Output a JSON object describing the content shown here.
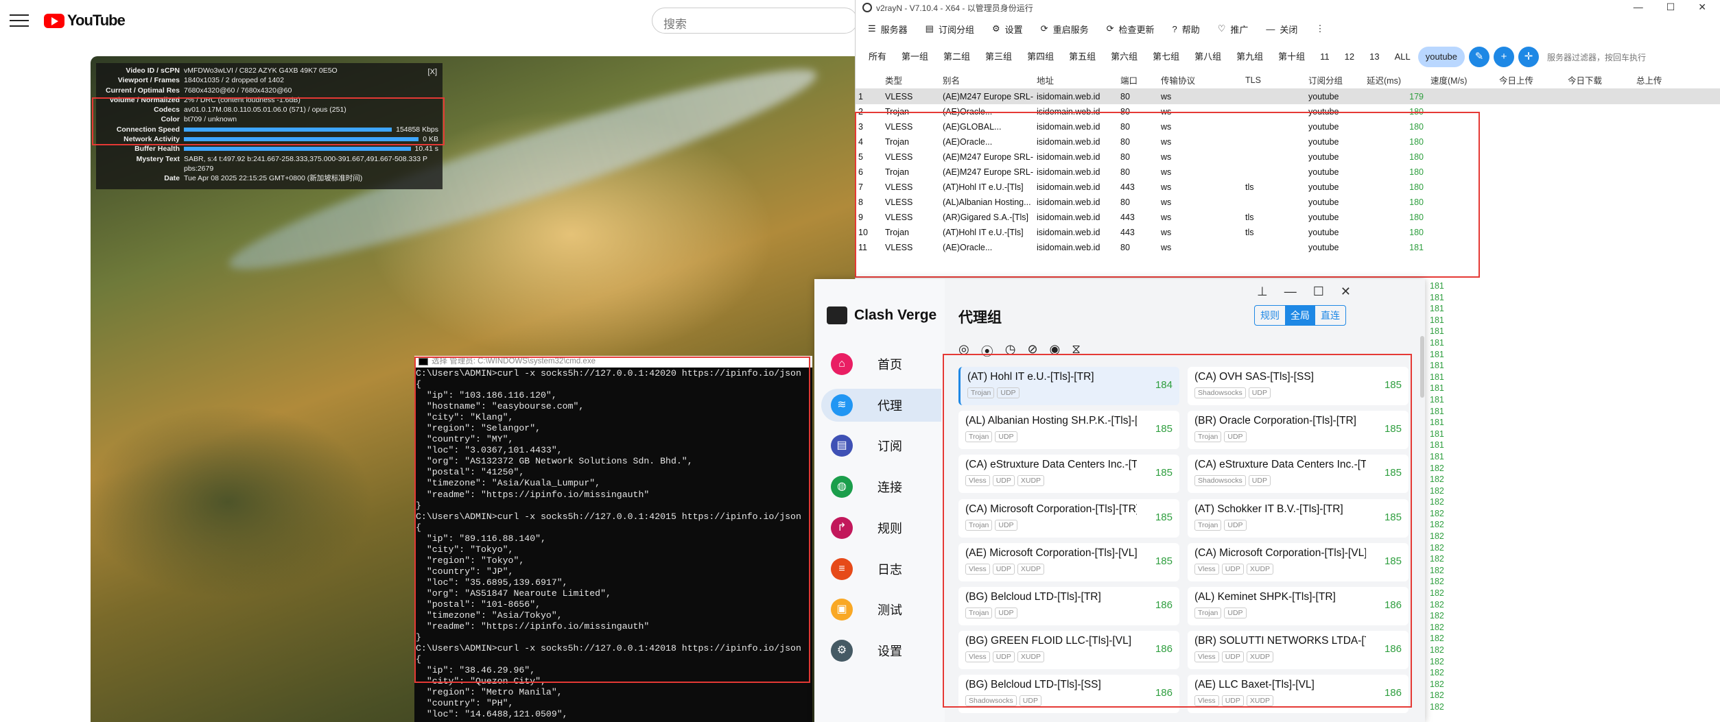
{
  "youtube": {
    "logo_text": "YouTube",
    "search_placeholder": "搜索"
  },
  "stats": {
    "rows": [
      {
        "k": "Video ID / sCPN",
        "v": "vMFDWo3wLVI / C822 AZYK G4XB 49K7 0E5O"
      },
      {
        "k": "Viewport / Frames",
        "v": "1840x1035 / 2 dropped of 1402"
      },
      {
        "k": "Current / Optimal Res",
        "v": "7680x4320@60 / 7680x4320@60"
      },
      {
        "k": "Volume / Normalized",
        "v": "2% / DRC (content loudness -1.6dB)"
      },
      {
        "k": "Codecs",
        "v": "av01.0.17M.08.0.110.05.01.06.0 (571) / opus (251)"
      },
      {
        "k": "Color",
        "v": "bt709 / unknown"
      },
      {
        "k": "Connection Speed",
        "v": "154858 Kbps",
        "bar": true
      },
      {
        "k": "Network Activity",
        "v": "0 KB",
        "bar": true
      },
      {
        "k": "Buffer Health",
        "v": "10.41 s",
        "bar": true
      },
      {
        "k": "Mystery Text",
        "v": "SABR, s:4 t:497.92 b:241.667-258.333,375.000-391.667,491.667-508.333 P"
      },
      {
        "k": "",
        "v": "pbs:2679"
      },
      {
        "k": "Date",
        "v": "Tue Apr 08 2025 22:15:25 GMT+0800 (新加坡标准时间)"
      }
    ],
    "close": "[X]"
  },
  "cmd": {
    "title": "选择 管理员: C:\\WINDOWS\\system32\\cmd.exe",
    "lines": [
      "C:\\Users\\ADMIN>curl -x socks5h://127.0.0.1:42020 https://ipinfo.io/json",
      "{",
      "  \"ip\": \"103.186.116.120\",",
      "  \"hostname\": \"easybourse.com\",",
      "  \"city\": \"Klang\",",
      "  \"region\": \"Selangor\",",
      "  \"country\": \"MY\",",
      "  \"loc\": \"3.0367,101.4433\",",
      "  \"org\": \"AS132372 GB Network Solutions Sdn. Bhd.\",",
      "  \"postal\": \"41250\",",
      "  \"timezone\": \"Asia/Kuala_Lumpur\",",
      "  \"readme\": \"https://ipinfo.io/missingauth\"",
      "}",
      "C:\\Users\\ADMIN>curl -x socks5h://127.0.0.1:42015 https://ipinfo.io/json",
      "{",
      "  \"ip\": \"89.116.88.140\",",
      "  \"city\": \"Tokyo\",",
      "  \"region\": \"Tokyo\",",
      "  \"country\": \"JP\",",
      "  \"loc\": \"35.6895,139.6917\",",
      "  \"org\": \"AS51847 Nearoute Limited\",",
      "  \"postal\": \"101-8656\",",
      "  \"timezone\": \"Asia/Tokyo\",",
      "  \"readme\": \"https://ipinfo.io/missingauth\"",
      "}",
      "C:\\Users\\ADMIN>curl -x socks5h://127.0.0.1:42018 https://ipinfo.io/json",
      "{",
      "  \"ip\": \"38.46.29.96\",",
      "  \"city\": \"Quezon City\",",
      "  \"region\": \"Metro Manila\",",
      "  \"country\": \"PH\",",
      "  \"loc\": \"14.6488,121.0509\","
    ]
  },
  "v2rayn": {
    "title": "v2rayN - V7.10.4 - X64 - 以管理员身份运行",
    "menu": [
      {
        "icon": "☰",
        "label": "服务器"
      },
      {
        "icon": "▤",
        "label": "订阅分组"
      },
      {
        "icon": "⚙",
        "label": "设置"
      },
      {
        "icon": "⟳",
        "label": "重启服务"
      },
      {
        "icon": "⟳",
        "label": "检查更新"
      },
      {
        "icon": "?",
        "label": "帮助"
      },
      {
        "icon": "♡",
        "label": "推广"
      },
      {
        "icon": "—",
        "label": "关闭"
      },
      {
        "icon": "⋮",
        "label": ""
      }
    ],
    "groups": [
      "所有",
      "第一组",
      "第二组",
      "第三组",
      "第四组",
      "第五组",
      "第六组",
      "第七组",
      "第八组",
      "第九组",
      "第十组",
      "11",
      "12",
      "13",
      "ALL",
      "youtube"
    ],
    "selected_group": "youtube",
    "filter_placeholder": "服务器过滤器，按回车执行",
    "columns": [
      "",
      "类型",
      "别名",
      "地址",
      "端口",
      "传输协议",
      "TLS",
      "订阅分组",
      "延迟(ms)",
      "速度(M/s)",
      "今日上传",
      "今日下载",
      "总上传"
    ],
    "rows": [
      [
        "1",
        "VLESS",
        "(AE)M247 Europe SRL-...",
        "isidomain.web.id",
        "80",
        "ws",
        "",
        "youtube",
        "179"
      ],
      [
        "2",
        "Trojan",
        "(AE)Oracle...",
        "isidomain.web.id",
        "80",
        "ws",
        "",
        "youtube",
        "180"
      ],
      [
        "3",
        "VLESS",
        "(AE)GLOBAL...",
        "isidomain.web.id",
        "80",
        "ws",
        "",
        "youtube",
        "180"
      ],
      [
        "4",
        "Trojan",
        "(AE)Oracle...",
        "isidomain.web.id",
        "80",
        "ws",
        "",
        "youtube",
        "180"
      ],
      [
        "5",
        "VLESS",
        "(AE)M247 Europe SRL-...",
        "isidomain.web.id",
        "80",
        "ws",
        "",
        "youtube",
        "180"
      ],
      [
        "6",
        "Trojan",
        "(AE)M247 Europe SRL-...",
        "isidomain.web.id",
        "80",
        "ws",
        "",
        "youtube",
        "180"
      ],
      [
        "7",
        "VLESS",
        "(AT)Hohl IT e.U.-[Tls]",
        "isidomain.web.id",
        "443",
        "ws",
        "tls",
        "youtube",
        "180"
      ],
      [
        "8",
        "VLESS",
        "(AL)Albanian Hosting...",
        "isidomain.web.id",
        "80",
        "ws",
        "",
        "youtube",
        "180"
      ],
      [
        "9",
        "VLESS",
        "(AR)Gigared S.A.-[Tls]",
        "isidomain.web.id",
        "443",
        "ws",
        "tls",
        "youtube",
        "180"
      ],
      [
        "10",
        "Trojan",
        "(AT)Hohl IT e.U.-[Tls]",
        "isidomain.web.id",
        "443",
        "ws",
        "tls",
        "youtube",
        "180"
      ],
      [
        "11",
        "VLESS",
        "(AE)Oracle...",
        "isidomain.web.id",
        "80",
        "ws",
        "",
        "youtube",
        "181"
      ]
    ],
    "side_latencies": [
      "181",
      "181",
      "181",
      "181",
      "181",
      "181",
      "181",
      "181",
      "181",
      "181",
      "181",
      "181",
      "181",
      "181",
      "181",
      "181",
      "182",
      "182",
      "182",
      "182",
      "182",
      "182",
      "182",
      "182",
      "182",
      "182",
      "182",
      "182",
      "182",
      "182",
      "182",
      "182",
      "182",
      "182",
      "182",
      "182",
      "182",
      "182"
    ]
  },
  "clash": {
    "app_name": "Clash Verge",
    "title": "代理组",
    "nav": [
      {
        "label": "首页",
        "icon": "⌂",
        "color": "#e91e63"
      },
      {
        "label": "代理",
        "icon": "≋",
        "color": "#2196f3"
      },
      {
        "label": "订阅",
        "icon": "▤",
        "color": "#3f51b5"
      },
      {
        "label": "连接",
        "icon": "◍",
        "color": "#1b9e4b"
      },
      {
        "label": "规则",
        "icon": "↱",
        "color": "#c2185b"
      },
      {
        "label": "日志",
        "icon": "≡",
        "color": "#e64a19"
      },
      {
        "label": "测试",
        "icon": "▣",
        "color": "#f9a825"
      },
      {
        "label": "设置",
        "icon": "⚙",
        "color": "#455a64"
      }
    ],
    "selected_nav": "代理",
    "modes": [
      "规则",
      "全局",
      "直连"
    ],
    "selected_mode": "全局",
    "tools": [
      "◎",
      "⦿",
      "◷",
      "⊘",
      "◉",
      "⧖"
    ],
    "proxies": [
      {
        "name": "(AT) Hohl IT e.U.-[Tls]-[TR]",
        "tags": [
          "Trojan",
          "UDP"
        ],
        "latency": "184",
        "selected": true
      },
      {
        "name": "(CA) OVH SAS-[Tls]-[SS]",
        "tags": [
          "Shadowsocks",
          "UDP"
        ],
        "latency": "185"
      },
      {
        "name": "(AL) Albanian Hosting SH.P.K.-[Tls]-[TR]",
        "tags": [
          "Trojan",
          "UDP"
        ],
        "latency": "185"
      },
      {
        "name": "(BR) Oracle Corporation-[Tls]-[TR]",
        "tags": [
          "Trojan",
          "UDP"
        ],
        "latency": "185"
      },
      {
        "name": "(CA) eStruxture Data Centers Inc.-[Tls...",
        "tags": [
          "Vless",
          "UDP",
          "XUDP"
        ],
        "latency": "185"
      },
      {
        "name": "(CA) eStruxture Data Centers Inc.-[Tls...",
        "tags": [
          "Shadowsocks",
          "UDP"
        ],
        "latency": "185"
      },
      {
        "name": "(CA) Microsoft Corporation-[Tls]-[TR]",
        "tags": [
          "Trojan",
          "UDP"
        ],
        "latency": "185"
      },
      {
        "name": "(AT) Schokker IT B.V.-[Tls]-[TR]",
        "tags": [
          "Trojan",
          "UDP"
        ],
        "latency": "185"
      },
      {
        "name": "(AE) Microsoft Corporation-[Tls]-[VL]",
        "tags": [
          "Vless",
          "UDP",
          "XUDP"
        ],
        "latency": "185"
      },
      {
        "name": "(CA) Microsoft Corporation-[Tls]-[VL]",
        "tags": [
          "Vless",
          "UDP",
          "XUDP"
        ],
        "latency": "185"
      },
      {
        "name": "(BG) Belcloud LTD-[Tls]-[TR]",
        "tags": [
          "Trojan",
          "UDP"
        ],
        "latency": "186"
      },
      {
        "name": "(AL) Keminet SHPK-[Tls]-[TR]",
        "tags": [
          "Trojan",
          "UDP"
        ],
        "latency": "186"
      },
      {
        "name": "(BG) GREEN FLOID LLC-[Tls]-[VL]",
        "tags": [
          "Vless",
          "UDP",
          "XUDP"
        ],
        "latency": "186"
      },
      {
        "name": "(BR) SOLUTTI NETWORKS LTDA-[Tls]-...",
        "tags": [
          "Vless",
          "UDP",
          "XUDP"
        ],
        "latency": "186"
      },
      {
        "name": "(BG) Belcloud LTD-[Tls]-[SS]",
        "tags": [
          "Shadowsocks",
          "UDP"
        ],
        "latency": "186"
      },
      {
        "name": "(AE) LLC Baxet-[Tls]-[VL]",
        "tags": [
          "Vless",
          "UDP",
          "XUDP"
        ],
        "latency": "186"
      }
    ]
  }
}
